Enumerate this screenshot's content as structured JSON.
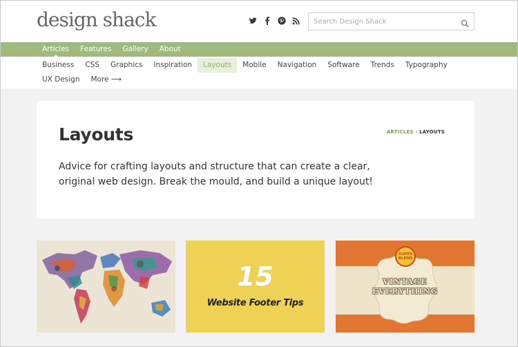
{
  "header": {
    "logo": "design shack",
    "social_icons": [
      "twitter-icon",
      "facebook-icon",
      "pinterest-icon",
      "rss-icon"
    ],
    "search_placeholder": "Search Design Shack"
  },
  "main_nav": {
    "items": [
      {
        "label": "Articles",
        "active": true
      },
      {
        "label": "Features",
        "active": false
      },
      {
        "label": "Gallery",
        "active": false
      },
      {
        "label": "About",
        "active": false
      }
    ]
  },
  "sub_nav": {
    "items": [
      {
        "label": "Business",
        "active": false
      },
      {
        "label": "CSS",
        "active": false
      },
      {
        "label": "Graphics",
        "active": false
      },
      {
        "label": "Inspiration",
        "active": false
      },
      {
        "label": "Layouts",
        "active": true
      },
      {
        "label": "Mobile",
        "active": false
      },
      {
        "label": "Navigation",
        "active": false
      },
      {
        "label": "Software",
        "active": false
      },
      {
        "label": "Trends",
        "active": false
      },
      {
        "label": "Typography",
        "active": false
      },
      {
        "label": "UX Design",
        "active": false
      },
      {
        "label": "More ⟶",
        "active": false
      }
    ]
  },
  "intro": {
    "title": "Layouts",
    "breadcrumb": {
      "parent": "ARTICLES",
      "separator": "›",
      "current": "LAYOUTS"
    },
    "description": "Advice for crafting layouts and structure that can create a clear, original web design. Break the mould, and build a unique layout!"
  },
  "cards": {
    "yellow": {
      "number": "15",
      "title": "Website Footer Tips"
    },
    "orange": {
      "badge": "SUPER BLEND",
      "title_line1": "VINTAGE",
      "title_line2": "EVERYTHING"
    }
  },
  "colors": {
    "nav_green": "#9fba7c",
    "active_green": "#8fb06a",
    "card_yellow": "#efd155",
    "card_orange": "#e27734"
  }
}
